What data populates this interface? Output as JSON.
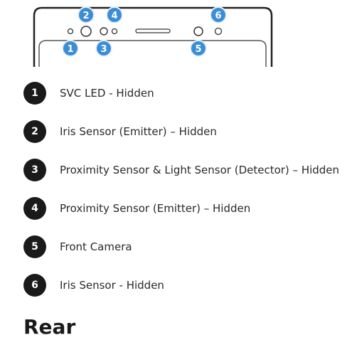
{
  "callouts": {
    "c1": "1",
    "c2": "2",
    "c3": "3",
    "c4": "4",
    "c5": "5",
    "c6": "6",
    "color": "#3b8ed6"
  },
  "legend": [
    {
      "number": "1",
      "label": "SVC LED - Hidden"
    },
    {
      "number": "2",
      "label": "Iris Sensor (Emitter) – Hidden"
    },
    {
      "number": "3",
      "label": "Proximity Sensor & Light Sensor (Detector) – Hidden"
    },
    {
      "number": "4",
      "label": "Proximity Sensor (Emitter) – Hidden"
    },
    {
      "number": "5",
      "label": "Front Camera"
    },
    {
      "number": "6",
      "label": "Iris Sensor - Hidden"
    }
  ],
  "heading": "Rear"
}
